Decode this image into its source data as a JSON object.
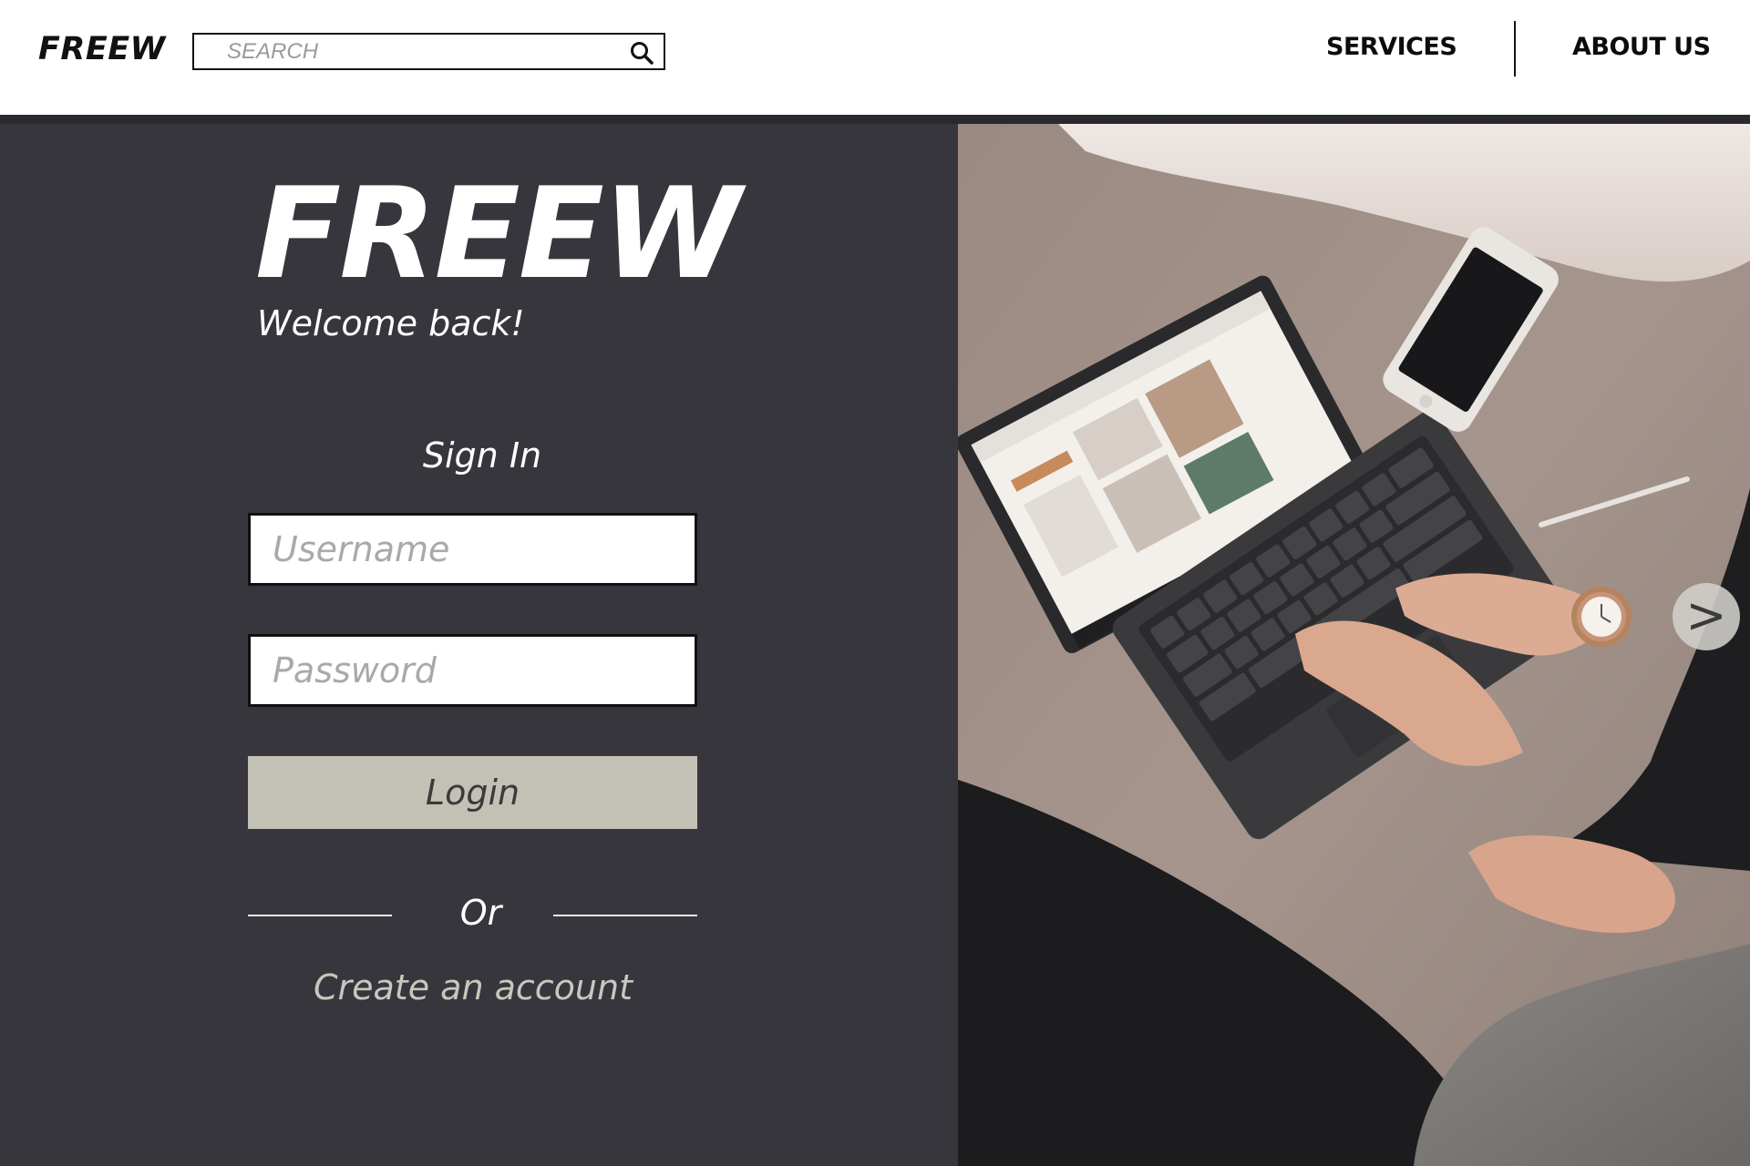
{
  "header": {
    "brand": "FREEW",
    "search_placeholder": "SEARCH",
    "nav": [
      {
        "label": "SERVICES"
      },
      {
        "label": "ABOUT US"
      }
    ]
  },
  "login": {
    "logo": "FREEW",
    "welcome": "Welcome back!",
    "title": "Sign In",
    "username_placeholder": "Username",
    "password_placeholder": "Password",
    "login_label": "Login",
    "or_label": "Or",
    "create_account_label": "Create an account"
  },
  "carousel": {
    "next_label": ">",
    "next_icon": "chevron-right-icon"
  },
  "colors": {
    "panel_bg": "#37363d",
    "login_button": "#c3c1b6",
    "create_link": "#c9c7bd",
    "header_bar": "#2a2a2e"
  }
}
